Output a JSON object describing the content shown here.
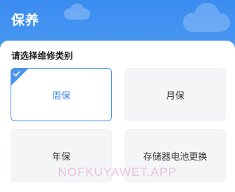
{
  "header": {
    "title": "保养",
    "background_color": "#3a8cf0"
  },
  "section": {
    "title": "请选择维修类别"
  },
  "options": [
    {
      "label": "周保",
      "selected": true
    },
    {
      "label": "月保",
      "selected": false
    },
    {
      "label": "年保",
      "selected": false
    },
    {
      "label": "存储器电池更换",
      "selected": false
    }
  ],
  "watermark": "NOFKUYAWET.APP",
  "colors": {
    "accent": "#3a86e8",
    "option_background": "#f4f5f7",
    "watermark": "#e296c8"
  },
  "icons": {
    "decor_left": "cloud-icon",
    "decor_right": "cloud-icon",
    "selected_marker": "checkmark-icon"
  }
}
